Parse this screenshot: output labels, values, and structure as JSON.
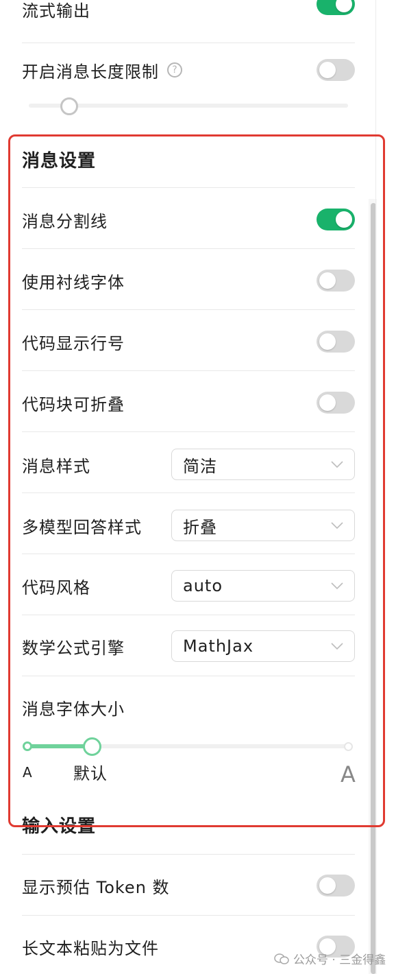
{
  "settings_top": {
    "streaming_output_label": "流式输出",
    "streaming_output_on": true,
    "msg_length_limit_label": "开启消息长度限制",
    "msg_length_limit_on": false,
    "help_icon": "question-circle-icon",
    "help_glyph": "?"
  },
  "message_settings": {
    "title": "消息设置",
    "items": [
      {
        "label": "消息分割线",
        "on": true
      },
      {
        "label": "使用衬线字体",
        "on": false
      },
      {
        "label": "代码显示行号",
        "on": false
      },
      {
        "label": "代码块可折叠",
        "on": false
      }
    ],
    "selects": [
      {
        "label": "消息样式",
        "value": "简洁"
      },
      {
        "label": "多模型回答样式",
        "value": "折叠"
      },
      {
        "label": "代码风格",
        "value": "auto"
      },
      {
        "label": "数学公式引擎",
        "value": "MathJax"
      }
    ],
    "font_size": {
      "label": "消息字体大小",
      "min_label": "A",
      "default_label": "默认",
      "max_label": "A"
    }
  },
  "input_settings": {
    "title": "输入设置",
    "show_token_estimate_label": "显示预估 Token 数",
    "show_token_estimate_on": false,
    "paste_long_text_label": "长文本粘贴为文件",
    "paste_long_text_on": false
  },
  "watermark": {
    "text": "公众号 · 三金得鑫",
    "icon": "wechat-icon"
  },
  "colors": {
    "toggle_on": "#19b26b",
    "toggle_off": "#d9d9d9",
    "highlight_frame": "#e03a31",
    "slider_fill": "#6fd29b"
  }
}
